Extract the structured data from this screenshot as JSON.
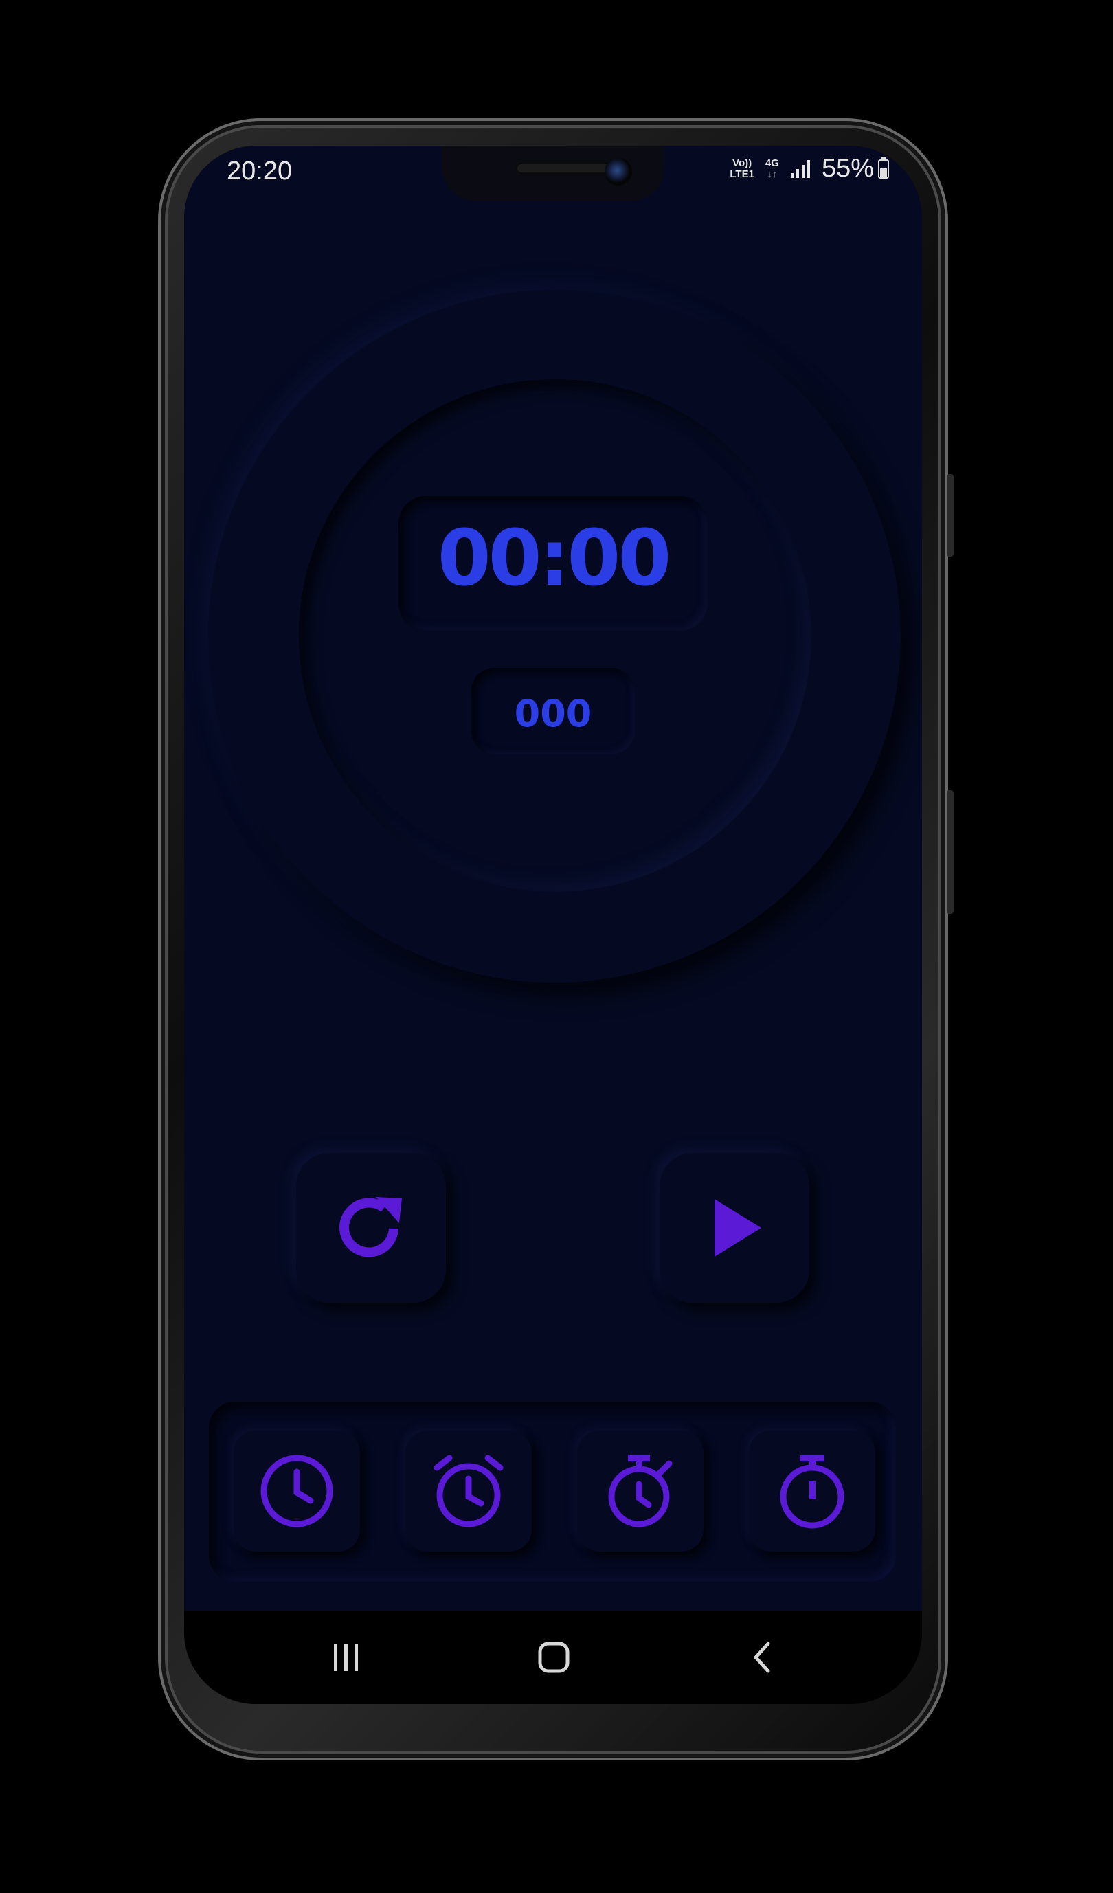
{
  "status_bar": {
    "time": "20:20",
    "volte_line1": "Vo))",
    "volte_line2": "LTE1",
    "network_line1": "4G",
    "network_line2": "↓↑",
    "battery_percent": "55%",
    "battery_level": 0.55
  },
  "stopwatch": {
    "time": "00:00",
    "milliseconds": "000"
  },
  "controls": {
    "reset_icon": "refresh-icon",
    "play_icon": "play-icon"
  },
  "tabs": [
    {
      "icon": "clock-icon"
    },
    {
      "icon": "alarm-clock-icon"
    },
    {
      "icon": "timer-icon"
    },
    {
      "icon": "stopwatch-icon"
    }
  ],
  "colors": {
    "background": "#050a22",
    "digit_blue": "#2b3ee6",
    "accent_violet": "#5a1ad6"
  }
}
